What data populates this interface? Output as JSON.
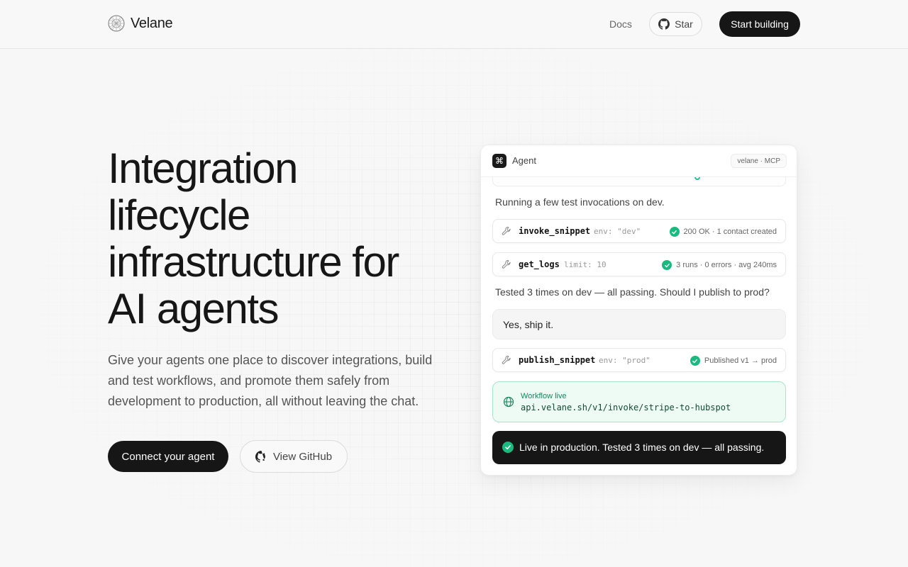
{
  "nav": {
    "brand": "Velane",
    "docs": "Docs",
    "star": "Star",
    "cta": "Start building"
  },
  "hero": {
    "title": "Integration lifecycle infrastructure for AI agents",
    "subtitle": "Give your agents one place to discover integrations, build and test workflows, and promote them safely from development to production, all without leaving the chat.",
    "primary_cta": "Connect your agent",
    "secondary_cta": "View GitHub"
  },
  "card": {
    "header": {
      "label": "Agent",
      "badge": "velane · MCP"
    },
    "message1": "Running a few test invocations on dev.",
    "tools": [
      {
        "name": "invoke_snippet",
        "arg": "env: \"dev\"",
        "status": "200 OK · 1 contact created"
      },
      {
        "name": "get_logs",
        "arg": "limit: 10",
        "status": "3 runs · 0 errors · avg 240ms"
      },
      {
        "name": "publish_snippet",
        "arg": "env: \"prod\"",
        "status": "Published v1 → prod"
      }
    ],
    "message2": "Tested 3 times on dev — all passing. Should I publish to prod?",
    "user_reply": "Yes, ship it.",
    "live": {
      "label": "Workflow live",
      "url": "api.velane.sh/v1/invoke/stripe-to-hubspot"
    },
    "toast": "Live in production. Tested 3 times on dev — all passing."
  },
  "colors": {
    "accent_dark": "#161616",
    "success": "#19b97f",
    "live_bg": "#eefbf5"
  }
}
